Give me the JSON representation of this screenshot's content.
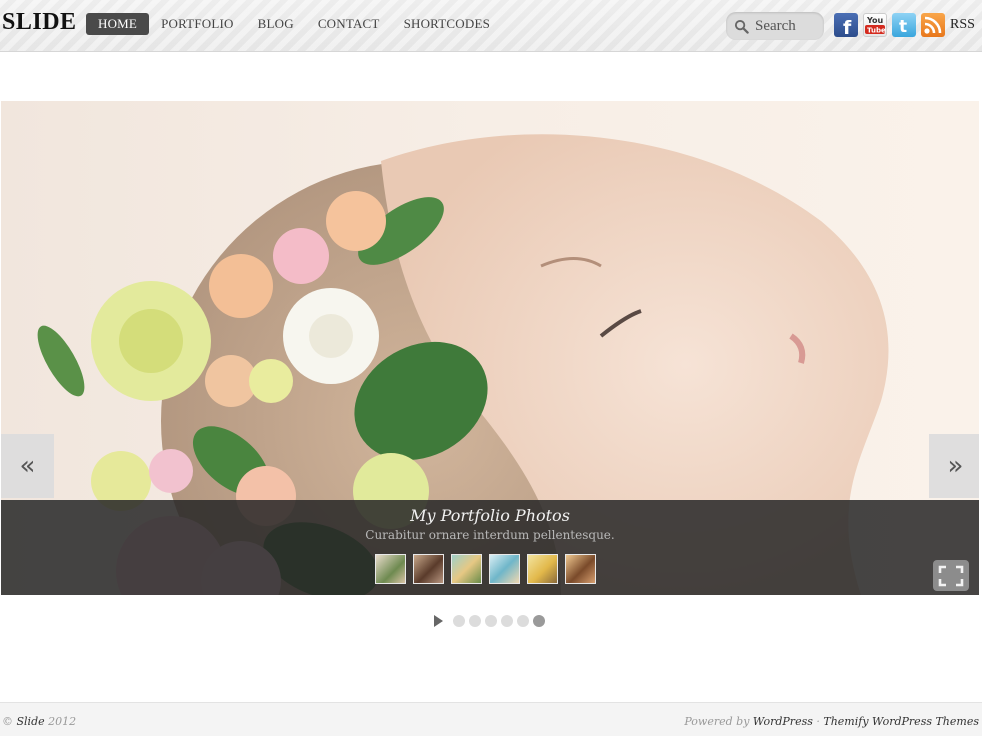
{
  "header": {
    "logo": "SLIDE",
    "nav": [
      {
        "label": "HOME",
        "active": true
      },
      {
        "label": "PORTFOLIO",
        "active": false
      },
      {
        "label": "BLOG",
        "active": false
      },
      {
        "label": "CONTACT",
        "active": false
      },
      {
        "label": "SHORTCODES",
        "active": false
      }
    ],
    "search_placeholder": "Search",
    "social": {
      "facebook_icon": "facebook-icon",
      "youtube_icon": "youtube-icon",
      "twitter_icon": "twitter-icon",
      "rss_icon": "rss-icon",
      "rss_label": "RSS"
    }
  },
  "slider": {
    "prev_label": "«",
    "next_label": "»",
    "caption_title": "My Portfolio Photos",
    "caption_subtitle": "Curabitur ornare interdum pellentesque.",
    "thumbnail_count": 6,
    "active_slide": 6,
    "slide_count": 6
  },
  "footer": {
    "copyright_symbol": "©",
    "site_name": "Slide",
    "year": "2012",
    "powered_by": "Powered by",
    "wordpress": "WordPress",
    "separator": "·",
    "themify": "Themify WordPress Themes"
  },
  "colors": {
    "nav_active_bg": "#4a4a4a",
    "caption_bg": "#282828",
    "footer_bg": "#f4f4f4"
  }
}
